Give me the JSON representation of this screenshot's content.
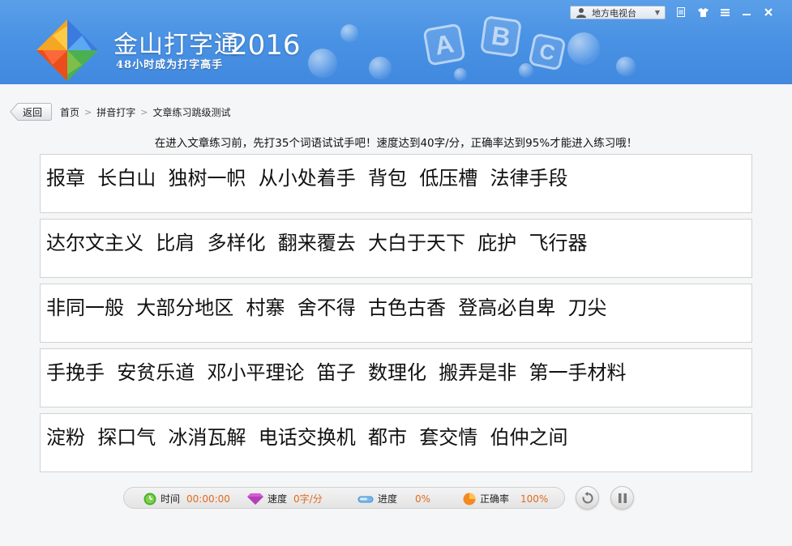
{
  "app": {
    "title": "金山打字通",
    "year": "2016",
    "subtitle": "48小时成为打字高手",
    "tiles": [
      "A",
      "B",
      "C"
    ]
  },
  "titlebar": {
    "channel_label": "地方电视台"
  },
  "nav": {
    "back_label": "返回",
    "breadcrumb": [
      "首页",
      "拼音打字",
      "文章练习跳级测试"
    ],
    "separator": ">"
  },
  "instruction": "在进入文章练习前，先打35个词语试试手吧！速度达到40字/分，正确率达到95%才能进入练习哦！",
  "word_lines": [
    "报章  长白山  独树一帜  从小处着手  背包  低压槽  法律手段",
    "达尔文主义  比肩  多样化  翻来覆去  大白于天下  庇护  飞行器",
    "非同一般  大部分地区  村寨  舍不得  古色古香  登高必自卑  刀尖",
    "手挽手  安贫乐道  邓小平理论  笛子  数理化  搬弄是非  第一手材料",
    "淀粉  探口气  冰消瓦解  电话交换机  都市  套交情  伯仲之间"
  ],
  "stats": {
    "time_label": "时间",
    "time_value": "00:00:00",
    "speed_label": "速度",
    "speed_value": "0字/分",
    "progress_label": "进度",
    "progress_value": "0%",
    "accuracy_label": "正确率",
    "accuracy_value": "100%"
  },
  "icons": {
    "time": "clock-icon",
    "speed": "diamond-icon",
    "progress": "progress-bar-icon",
    "accuracy": "pie-icon",
    "restart": "restart-icon",
    "pause": "pause-icon"
  },
  "colors": {
    "header_blue": "#4a92e4",
    "stat_value": "#e26a1e"
  }
}
